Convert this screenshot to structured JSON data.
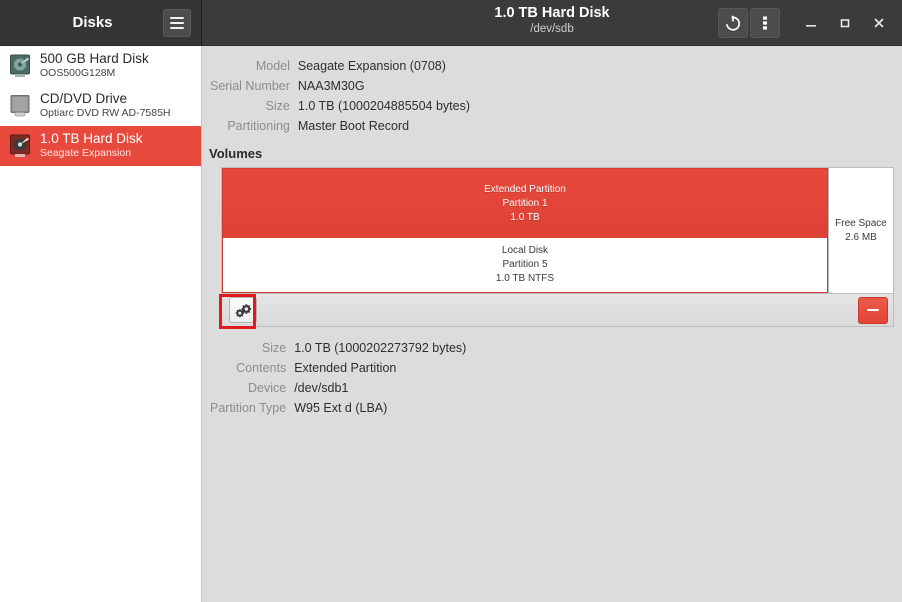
{
  "window": {
    "sidebar_title": "Disks",
    "title": "1.0 TB Hard Disk",
    "subtitle": "/dev/sdb",
    "menu_icon": "hamburger-icon",
    "power_icon": "power-icon",
    "overflow_icon": "vertical-dots-icon",
    "minimize_icon": "minimize-icon",
    "maximize_icon": "maximize-icon",
    "close_icon": "close-icon"
  },
  "sidebar": {
    "items": [
      {
        "title": "500 GB Hard Disk",
        "subtitle": "OOS500G128M",
        "icon": "hard-disk-icon",
        "selected": false
      },
      {
        "title": "CD/DVD Drive",
        "subtitle": "Optiarc DVD RW AD-7585H",
        "icon": "optical-drive-icon",
        "selected": false
      },
      {
        "title": "1.0 TB Hard Disk",
        "subtitle": "Seagate Expansion",
        "icon": "hard-disk-icon",
        "selected": true
      }
    ]
  },
  "drive": {
    "rows": [
      {
        "key": "Model",
        "value": "Seagate Expansion (0708)"
      },
      {
        "key": "Serial Number",
        "value": "NAA3M30G"
      },
      {
        "key": "Size",
        "value": "1.0 TB (1000204885504 bytes)"
      },
      {
        "key": "Partitioning",
        "value": "Master Boot Record"
      }
    ]
  },
  "volumes": {
    "heading": "Volumes",
    "extended": {
      "name": "Extended Partition",
      "number": "Partition 1",
      "size": "1.0 TB"
    },
    "inner": {
      "name": "Local Disk",
      "number": "Partition 5",
      "size": "1.0 TB NTFS"
    },
    "free": {
      "name": "Free Space",
      "size": "2.6 MB"
    },
    "toolbar": {
      "gear_icon": "gears-icon",
      "delete_icon": "minus-icon"
    }
  },
  "partition": {
    "rows": [
      {
        "key": "Size",
        "value": "1.0 TB (1000202273792 bytes)"
      },
      {
        "key": "Contents",
        "value": "Extended Partition"
      },
      {
        "key": "Device",
        "value": "/dev/sdb1"
      },
      {
        "key": "Partition Type",
        "value": "W95 Ext d (LBA)"
      }
    ]
  },
  "colors": {
    "accent_red": "#e8483c",
    "titlebar": "#3b3b3b",
    "background": "#dcdcdc",
    "highlight": "#e11b1b"
  }
}
